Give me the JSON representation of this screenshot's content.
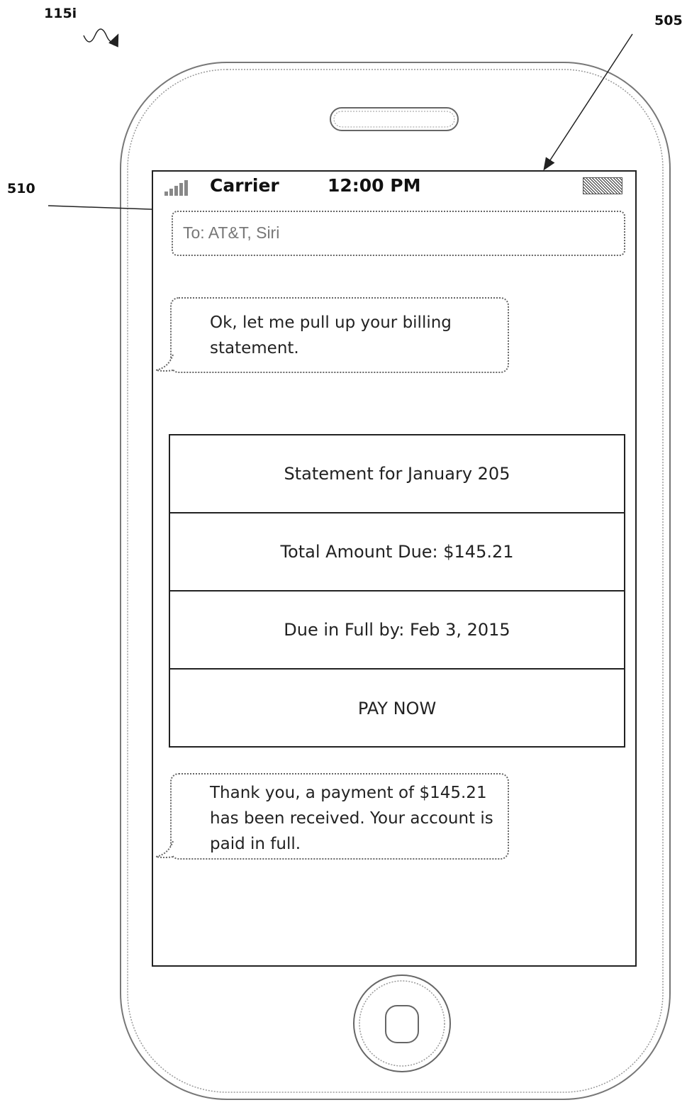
{
  "figure": {
    "device_ref": "115i",
    "screen_ref": "505",
    "field_ref": "510"
  },
  "status_bar": {
    "carrier": "Carrier",
    "time": "12:00 PM",
    "signal_icon": "signal-bars-icon",
    "battery_icon": "battery-icon"
  },
  "recipients": {
    "value": "To: AT&T, Siri"
  },
  "messages": [
    {
      "lines": [
        "Ok, let me pull up your billing",
        "statement."
      ]
    },
    {
      "lines": [
        "Thank you, a payment of $145.21",
        "has been received. Your account is",
        "paid in full."
      ]
    }
  ],
  "statement": {
    "title": "Statement for January 205",
    "amount_due": "Total Amount Due: $145.21",
    "due_date": "Due in Full by: Feb 3, 2015",
    "pay_label": "PAY NOW"
  }
}
